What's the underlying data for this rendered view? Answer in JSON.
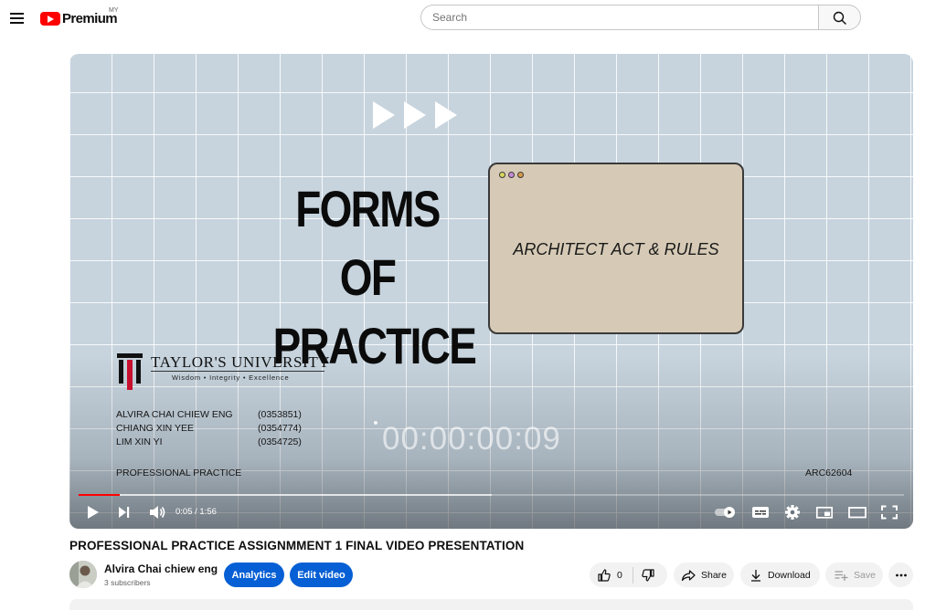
{
  "header": {
    "logo_text": "Premium",
    "logo_country": "MY",
    "search_placeholder": "Search"
  },
  "player": {
    "slide": {
      "title_line1": "FORMS OF",
      "title_line2": "PRACTICE",
      "window_text": "ARCHITECT ACT & RULES",
      "university_name": "TAYLOR'S UNIVERSITY",
      "university_tagline": "Wisdom • Integrity • Excellence",
      "members": [
        {
          "name": "ALVIRA CHAI CHIEW ENG",
          "id": "(0353851)"
        },
        {
          "name": "CHIANG XIN YEE",
          "id": "(0354774)"
        },
        {
          "name": "LIM XIN YI",
          "id": "(0354725)"
        }
      ],
      "course": "PROFESSIONAL PRACTICE",
      "course_code": "ARC62604",
      "timecode": "00:00:00:09"
    },
    "current_time": "0:05",
    "duration": "1:56",
    "time_display": "0:05 / 1:56",
    "played_fraction": 0.05,
    "buffered_fraction": 0.5
  },
  "video": {
    "title": "PROFESSIONAL PRACTICE ASSIGNMMENT 1 FINAL VIDEO PRESENTATION",
    "channel_name": "Alvira Chai chiew eng",
    "subscribers": "3 subscribers",
    "analytics_label": "Analytics",
    "edit_label": "Edit video",
    "like_count": "0",
    "share_label": "Share",
    "download_label": "Download",
    "save_label": "Save"
  },
  "colors": {
    "accent": "#065fd4",
    "brand": "#ff0000",
    "pill_bg": "#f2f2f2"
  }
}
